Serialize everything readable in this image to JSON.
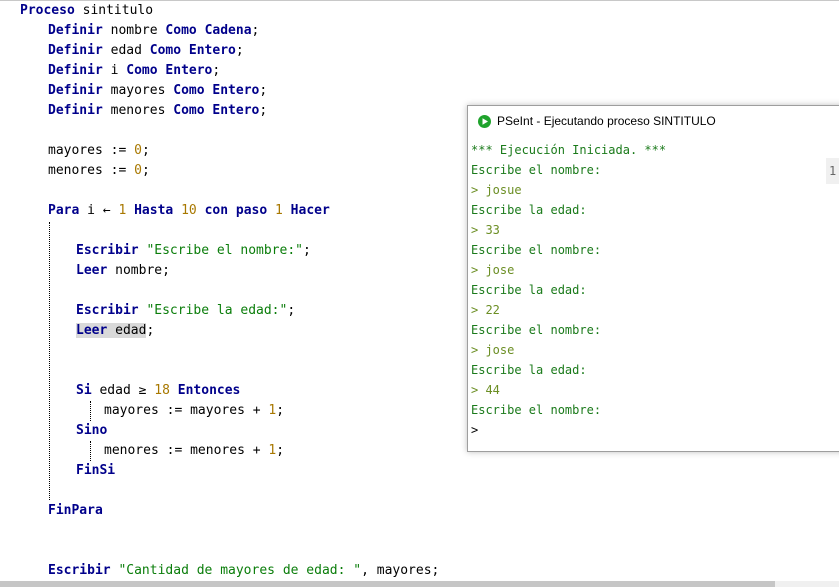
{
  "code": {
    "proceso_kw": "Proceso",
    "proceso_name": " sintitulo",
    "definir_kw": "Definir",
    "como_kw": "Como",
    "cadena_kw": "Cadena",
    "entero_kw": "Entero",
    "var_nombre": "nombre",
    "var_edad": "edad",
    "var_i": "i",
    "var_mayores": "mayores",
    "var_menores": "menores",
    "semicolon": ";",
    "assign_op": " := ",
    "zero": "0",
    "one": "1",
    "eighteen": "18",
    "ten": "10",
    "para_kw": "Para",
    "arrow_op": " ← ",
    "hasta_kw": "Hasta",
    "con_paso_kw": "con paso",
    "hacer_kw": "Hacer",
    "escribir_kw": "Escribir",
    "leer_kw": "Leer",
    "str_nombre": "\"Escribe el nombre:\"",
    "str_edad": "\"Escribe la edad:\"",
    "si_kw": "Si",
    "gte_op": " ≥ ",
    "entonces_kw": "Entonces",
    "plus_op": " + ",
    "sino_kw": "Sino",
    "finsi_kw": "FinSi",
    "finpara_kw": "FinPara",
    "str_mayores": "\"Cantidad de mayores de edad: \"",
    "comma_mayores": ", mayores;"
  },
  "console": {
    "title": "PSeInt - Ejecutando proceso SINTITULO",
    "lines": [
      "*** Ejecución Iniciada. ***",
      "Escribe el nombre:",
      "> josue",
      "Escribe la edad:",
      "> 33",
      "Escribe el nombre:",
      "> jose",
      "Escribe la edad:",
      "> 22",
      "Escribe el nombre:",
      "> jose",
      "Escribe la edad:",
      "> 44",
      "Escribe el nombre:",
      ">"
    ],
    "side_text": "1:"
  },
  "colors": {
    "keyword_blue": "#00008b",
    "number": "#a87800",
    "string": "#0a7d0a",
    "console_green": "#1a7a1a",
    "console_input": "#6b8e23"
  },
  "icons": {
    "console_app": "pseint-play-icon"
  }
}
